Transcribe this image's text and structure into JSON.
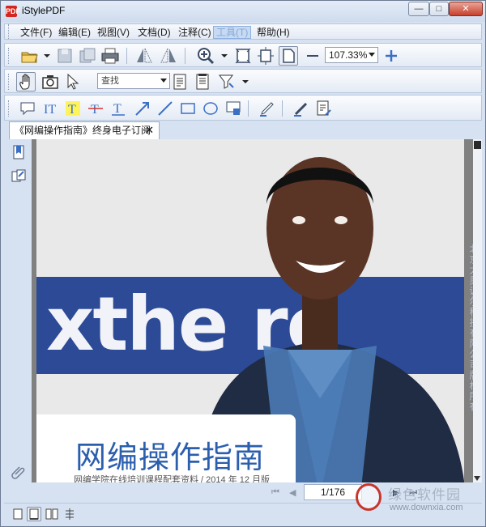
{
  "window": {
    "title": "iStylePDF",
    "app_icon_glyph": "PDF"
  },
  "menu": {
    "items": [
      {
        "label": "文件(F)"
      },
      {
        "label": "编辑(E)"
      },
      {
        "label": "视图(V)"
      },
      {
        "label": "文档(D)"
      },
      {
        "label": "注释(C)"
      },
      {
        "label": "工具(T)"
      },
      {
        "label": "帮助(H)"
      }
    ],
    "active_index": 5
  },
  "toolbar": {
    "zoom_value": "107.33%",
    "search_placeholder": "查找",
    "icons_row1": [
      "open-folder-icon",
      "save-icon",
      "save-as-icon",
      "print-icon",
      "flip-horizontal-icon",
      "flip-triangle-icon",
      "zoom-in-icon",
      "fit-page-icon",
      "fit-width-icon",
      "actual-size-icon",
      "zoom-out-icon",
      "zoom-plus-icon"
    ],
    "icons_row2": [
      "hand-tool-icon",
      "snapshot-icon",
      "select-arrow-icon",
      "page-list-icon",
      "page-notes-icon",
      "filter-icon"
    ],
    "icons_row3": [
      "comment-icon",
      "text-tool-icon",
      "highlight-icon",
      "strikethrough-icon",
      "underline-icon",
      "arrow-icon",
      "line-icon",
      "rectangle-icon",
      "ellipse-icon",
      "stamp-icon",
      "pen-tool-icon",
      "sign-icon",
      "document-edit-icon"
    ]
  },
  "tab": {
    "title": "《网编操作指南》终身电子订阅版",
    "close_glyph": "✕"
  },
  "document": {
    "banner_text": "xthe ro",
    "card_title": "网编操作指南",
    "card_subtitle": "网编学院在线培训课程配套资料 / 2014 年 12 月版",
    "side_vertical_text": "北京太奥诚尔科技有限公司版权所有"
  },
  "navigation": {
    "page_indicator": "1/176"
  },
  "watermark": {
    "text_cn": "绿色软件园",
    "url": "www.downxia.com"
  },
  "colors": {
    "accent": "#2b5fae",
    "banner": "#2c4a96",
    "chrome": "#d6e2f2",
    "close_btn": "#c7402b"
  }
}
